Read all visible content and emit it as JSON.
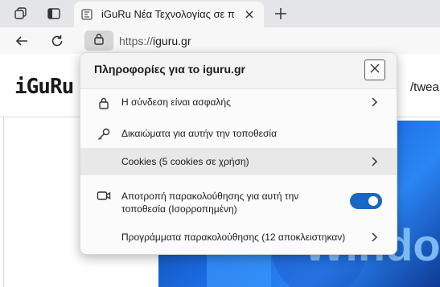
{
  "browser": {
    "tab": {
      "title": "iGuRu Νέα Τεχνολογίας σε πραγματικό χρόνο"
    },
    "address": {
      "scheme": "https://",
      "host": "iguru.gr"
    }
  },
  "site": {
    "logo_text": "iGuRu",
    "nav_text": "/twea"
  },
  "site_info_popup": {
    "title": "Πληροφορίες για το iguru.gr",
    "items": [
      {
        "label": "Η σύνδεση είναι ασφαλής",
        "icon": "lock-icon",
        "has_chevron": true
      },
      {
        "label": "Δικαιώματα για αυτήν την τοποθεσία",
        "icon": "key-icon",
        "has_chevron": false
      },
      {
        "label": "Cookies (5 cookies σε χρήση)",
        "icon": "",
        "has_chevron": true,
        "highlighted": true
      },
      {
        "label": "Αποτροπή παρακολούθησης για αυτή την τοποθεσία (Ισορροπημένη)",
        "icon": "tracking-camera-icon",
        "toggle_on": true
      },
      {
        "label": "Προγράμματα παρακολούθησης (12 αποκλειστηκαν)",
        "icon": "",
        "has_chevron": true
      }
    ]
  },
  "colors": {
    "accent": "#1966c5",
    "tabbar": "#e4e5e8",
    "toolbar": "#f7f7f7"
  }
}
